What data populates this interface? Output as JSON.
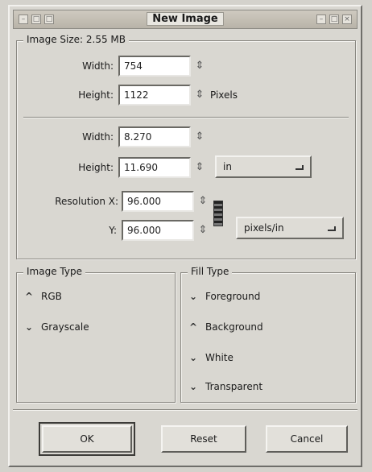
{
  "window": {
    "title": "New Image"
  },
  "size_group": {
    "title": "Image Size: 2.55 MB",
    "width_label": "Width:",
    "width_value": "754",
    "height_label": "Height:",
    "height_value": "1122",
    "unit_label": "Pixels",
    "print_width_label": "Width:",
    "print_width_value": "8.270",
    "print_height_label": "Height:",
    "print_height_value": "11.690",
    "print_unit": "in",
    "resolution_x_label": "Resolution X:",
    "resolution_x_value": "96.000",
    "resolution_y_label": "Y:",
    "resolution_y_value": "96.000",
    "resolution_unit": "pixels/in"
  },
  "image_type": {
    "title": "Image Type",
    "options": [
      {
        "label": "RGB",
        "selected": true
      },
      {
        "label": "Grayscale",
        "selected": false
      }
    ]
  },
  "fill_type": {
    "title": "Fill Type",
    "options": [
      {
        "label": "Foreground",
        "selected": false
      },
      {
        "label": "Background",
        "selected": true
      },
      {
        "label": "White",
        "selected": false
      },
      {
        "label": "Transparent",
        "selected": false
      }
    ]
  },
  "buttons": {
    "ok": "OK",
    "reset": "Reset",
    "cancel": "Cancel"
  },
  "glyphs": {
    "spinner": "⇕",
    "selected": "^",
    "unselected": "⌄"
  }
}
